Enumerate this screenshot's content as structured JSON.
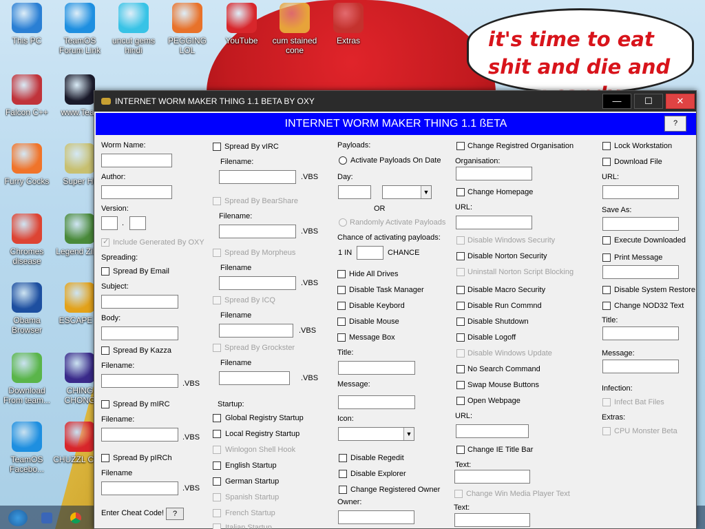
{
  "desktop": {
    "bubble_text": "it's time to eat shit and die and chew candy canes",
    "icons": [
      {
        "label": "This PC",
        "icon": "monitor-icon",
        "color": "#2a7fd4"
      },
      {
        "label": "TeamOS Forum Link",
        "icon": "gear-icon",
        "color": "#1e8fe0"
      },
      {
        "label": "uncut gems hindi",
        "icon": "gem-icon",
        "color": "#38c3e6"
      },
      {
        "label": "PEGGING LOL",
        "icon": "peggle-icon",
        "color": "#e8722a"
      },
      {
        "label": "YouTube",
        "icon": "angry-bird-icon",
        "color": "#d8262b"
      },
      {
        "label": "cum stained cone",
        "icon": "candy-corn-icon",
        "color": "#e7a33a"
      },
      {
        "label": "Extras",
        "icon": "extras-icon",
        "color": "#c4322e"
      },
      {
        "label": "Falcon C++",
        "icon": "falcon-icon",
        "color": "#c0333a"
      },
      {
        "label": "www.Tean",
        "icon": "book-icon",
        "color": "#1a1a2a"
      },
      {
        "label": "Furry Cocks",
        "icon": "firefox-icon",
        "color": "#f0742a"
      },
      {
        "label": "Super Hil",
        "icon": "pixel-icon",
        "color": "#c8c070"
      },
      {
        "label": "Chromes disease",
        "icon": "chrome-icon",
        "color": "#dd4433"
      },
      {
        "label": "Legend Zilda",
        "icon": "zelda-icon",
        "color": "#4a8a3a"
      },
      {
        "label": "Obama Browser",
        "icon": "obama-logo-icon",
        "color": "#1d4fa0"
      },
      {
        "label": "ESCAPE C",
        "icon": "escape-icon",
        "color": "#e3a21a"
      },
      {
        "label": "Download From team...",
        "icon": "notepad-icon",
        "color": "#5ab54a"
      },
      {
        "label": "CHING CHONG",
        "icon": "orb-icon",
        "color": "#3a2a8a"
      },
      {
        "label": "TeamOS Facebo...",
        "icon": "gear-icon",
        "color": "#1e8fe0"
      },
      {
        "label": "CHUZZL CUM",
        "icon": "chuzzle-icon",
        "color": "#d8262b"
      }
    ]
  },
  "window": {
    "title": "INTERNET WORM MAKER THING 1.1 BETA BY OXY",
    "banner": "INTERNET WORM MAKER THING 1.1 ßETA",
    "help_label": "?",
    "min_label": "—",
    "max_label": "☐",
    "close_label": "✕"
  },
  "col1": {
    "worm_name": "Worm Name:",
    "author": "Author:",
    "version": "Version:",
    "version_dot": ".",
    "include_generated": "Include Generated By OXY",
    "spreading": "Spreading:",
    "spread_email": "Spread By Email",
    "subject": "Subject:",
    "body": "Body:",
    "spread_kazza": "Spread By Kazza",
    "filename1": "Filename:",
    "vbs1": ".VBS",
    "spread_mirc": "Spread By mIRC",
    "filename2": "Filename:",
    "vbs2": ".VBS",
    "spread_pirch": "Spread By pIRCh",
    "filename3": "Filename",
    "vbs3": ".VBS",
    "cheat_code": "Enter Cheat Code!",
    "cheat_btn": "?"
  },
  "col2": {
    "spread_virc": "Spread By vIRC",
    "filename_virc": "Filename:",
    "vbs_virc": ".VBS",
    "spread_bearshare": "Spread By BearShare",
    "filename_bearshare": "Filename:",
    "vbs_bearshare": ".VBS",
    "spread_morpheus": "Spread By Morpheus",
    "filename_morpheus": "Filename",
    "vbs_morpheus": ".VBS",
    "spread_icq": "Spread By ICQ",
    "filename_icq": "Filename",
    "vbs_icq": ".VBS",
    "spread_grockster": "Spread By Grockster",
    "filename_grockster": "Filename",
    "vbs_grockster": ".VBS",
    "startup": "Startup:",
    "global_registry": "Global Registry Startup",
    "local_registry": "Local Registry Startup",
    "winlogon": "Winlogon Shell Hook",
    "english": "English Startup",
    "german": "German Startup",
    "spanish": "Spanish Startup",
    "french": "French Startup",
    "italian": "Italian Startup"
  },
  "col3": {
    "payloads": "Payloads:",
    "activate_on_date": "Activate Payloads On Date",
    "day": "Day:",
    "or": "OR",
    "randomly_activate": "Randomly Activate Payloads",
    "chance_label": "Chance of activating payloads:",
    "one_in": "1 IN",
    "chance": "CHANCE",
    "hide_drives": "Hide All Drives",
    "disable_task_manager": "Disable Task Manager",
    "disable_keyboard": "Disable Keybord",
    "disable_mouse": "Disable Mouse",
    "message_box": "Message Box",
    "title": "Title:",
    "message": "Message:",
    "icon": "Icon:",
    "disable_regedit": "Disable Regedit",
    "disable_explorer": "Disable Explorer",
    "change_registered_owner": "Change Registered Owner",
    "owner": "Owner:"
  },
  "col4": {
    "change_registered_org": "Change Registred Organisation",
    "organisation": "Organisation:",
    "change_homepage": "Change Homepage",
    "url": "URL:",
    "disable_windows_security": "Disable Windows Security",
    "disable_norton_security": "Disable Norton Security",
    "uninstall_norton": "Uninstall Norton Script Blocking",
    "disable_macro_security": "Disable Macro Security",
    "disable_run_command": "Disable Run Commnd",
    "disable_shutdown": "Disable Shutdown",
    "disable_logoff": "Disable Logoff",
    "disable_windows_update": "Disable Windows Update",
    "no_search_command": "No Search Command",
    "swap_mouse": "Swap Mouse Buttons",
    "open_webpage": "Open Webpage",
    "url2": "URL:",
    "change_ie_title": "Change IE Title Bar",
    "text": "Text:",
    "change_wmp_text": "Change Win Media Player Text",
    "text2": "Text:"
  },
  "col5": {
    "lock_workstation": "Lock Workstation",
    "download_file": "Download File",
    "url": "URL:",
    "save_as": "Save As:",
    "execute_downloaded": "Execute Downloaded",
    "print_message": "Print Message",
    "disable_system_restore": "Disable System Restore",
    "change_nod32": "Change NOD32 Text",
    "title": "Title:",
    "message": "Message:",
    "infection": "Infection:",
    "infect_bat": "Infect Bat Files",
    "extras": "Extras:",
    "cpu_monster": "CPU Monster Beta"
  }
}
